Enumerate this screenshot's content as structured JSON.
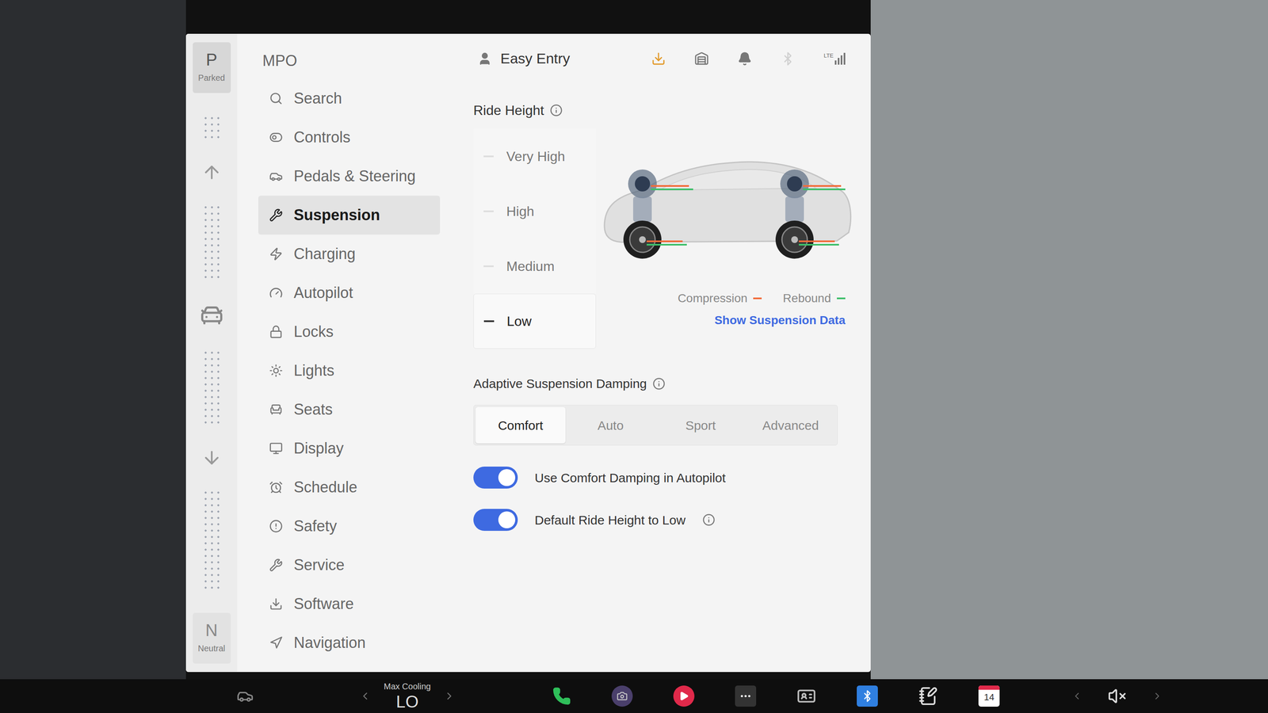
{
  "gear_selector": {
    "top": {
      "letter": "P",
      "label": "Parked",
      "selected": true
    },
    "bottom": {
      "letter": "N",
      "label": "Neutral",
      "selected": false
    }
  },
  "sidebar": {
    "title": "MPO",
    "items": [
      {
        "label": "Search",
        "selected": false
      },
      {
        "label": "Controls",
        "selected": false
      },
      {
        "label": "Pedals & Steering",
        "selected": false
      },
      {
        "label": "Suspension",
        "selected": true
      },
      {
        "label": "Charging",
        "selected": false
      },
      {
        "label": "Autopilot",
        "selected": false
      },
      {
        "label": "Locks",
        "selected": false
      },
      {
        "label": "Lights",
        "selected": false
      },
      {
        "label": "Seats",
        "selected": false
      },
      {
        "label": "Display",
        "selected": false
      },
      {
        "label": "Schedule",
        "selected": false
      },
      {
        "label": "Safety",
        "selected": false
      },
      {
        "label": "Service",
        "selected": false
      },
      {
        "label": "Software",
        "selected": false
      },
      {
        "label": "Navigation",
        "selected": false
      }
    ]
  },
  "header": {
    "profile": "Easy Entry",
    "network": "LTE"
  },
  "ride_height": {
    "label": "Ride Height",
    "options": [
      {
        "label": "Very High",
        "selected": false
      },
      {
        "label": "High",
        "selected": false
      },
      {
        "label": "Medium",
        "selected": false
      },
      {
        "label": "Low",
        "selected": true
      }
    ],
    "legend": [
      {
        "label": "Compression",
        "color": "#f26b3a"
      },
      {
        "label": "Rebound",
        "color": "#3fbf6a"
      }
    ],
    "link": "Show Suspension Data"
  },
  "damping": {
    "label": "Adaptive Suspension Damping",
    "options": [
      {
        "label": "Comfort",
        "selected": true
      },
      {
        "label": "Auto",
        "selected": false
      },
      {
        "label": "Sport",
        "selected": false
      },
      {
        "label": "Advanced",
        "selected": false
      }
    ]
  },
  "toggles": [
    {
      "label": "Use Comfort Damping in Autopilot",
      "on": true,
      "info": false
    },
    {
      "label": "Default Ride Height to Low",
      "on": true,
      "info": true
    }
  ],
  "taskbar": {
    "climate_label": "Max Cooling",
    "temperature": "LO",
    "calendar_day": "14",
    "muted": true
  }
}
